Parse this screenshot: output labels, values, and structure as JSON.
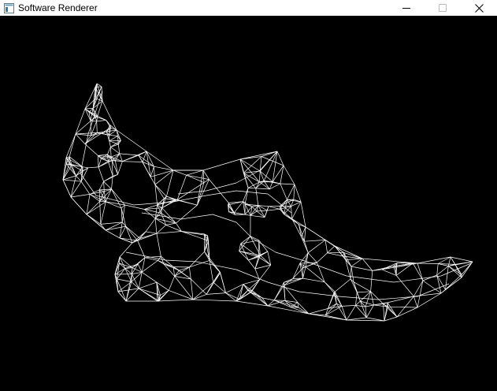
{
  "window": {
    "title": "Software Renderer",
    "icon": "app-window-icon",
    "controls": [
      {
        "name": "minimize-button",
        "icon": "minimize-icon"
      },
      {
        "name": "maximize-button",
        "icon": "maximize-icon"
      },
      {
        "name": "close-button",
        "icon": "close-icon"
      }
    ]
  },
  "viewport": {
    "background": "#000000",
    "wire_color": "#ffffff",
    "render_mode": "wireframe",
    "model": "shoe-mesh"
  }
}
